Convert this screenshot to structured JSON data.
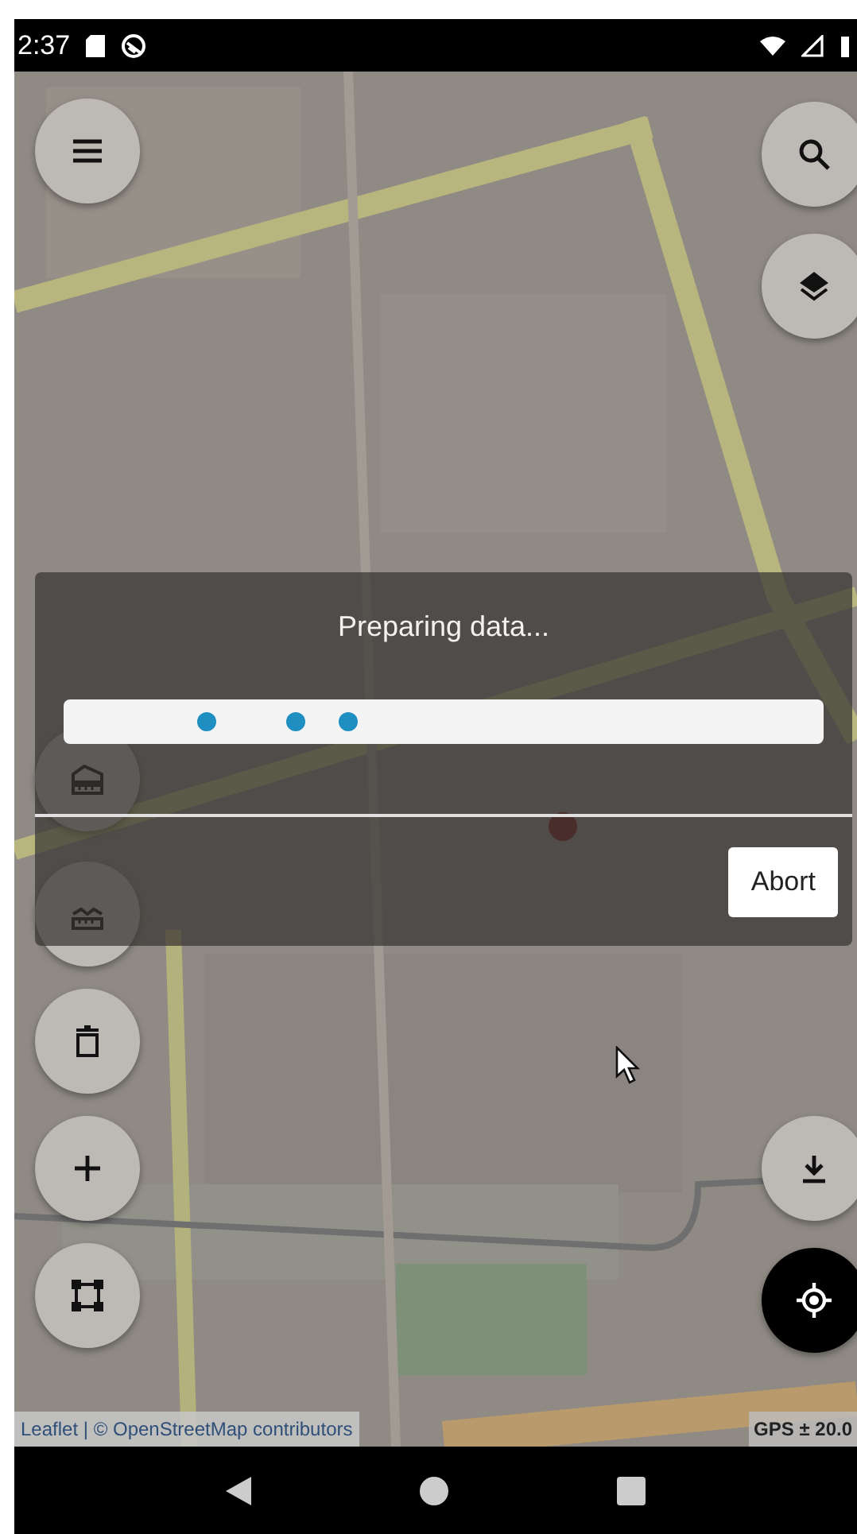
{
  "status_bar": {
    "time": "2:37"
  },
  "map": {
    "kind": "picture",
    "attribution": "Leaflet | © OpenStreetMap contributors",
    "gps_accuracy": "GPS ± 20.0"
  },
  "left_buttons": [
    {
      "kind": "menu"
    },
    {
      "kind": "ruler-roof"
    },
    {
      "kind": "ruler-wave"
    },
    {
      "kind": "delete"
    },
    {
      "kind": "add"
    },
    {
      "kind": "polygon"
    }
  ],
  "right_buttons": [
    {
      "kind": "search"
    },
    {
      "kind": "layers"
    },
    {
      "kind": "download"
    },
    {
      "kind": "locate"
    }
  ],
  "dialog": {
    "message": "Preparing data...",
    "progress": {
      "indeterminate": true
    },
    "abort_button": "Abort"
  }
}
